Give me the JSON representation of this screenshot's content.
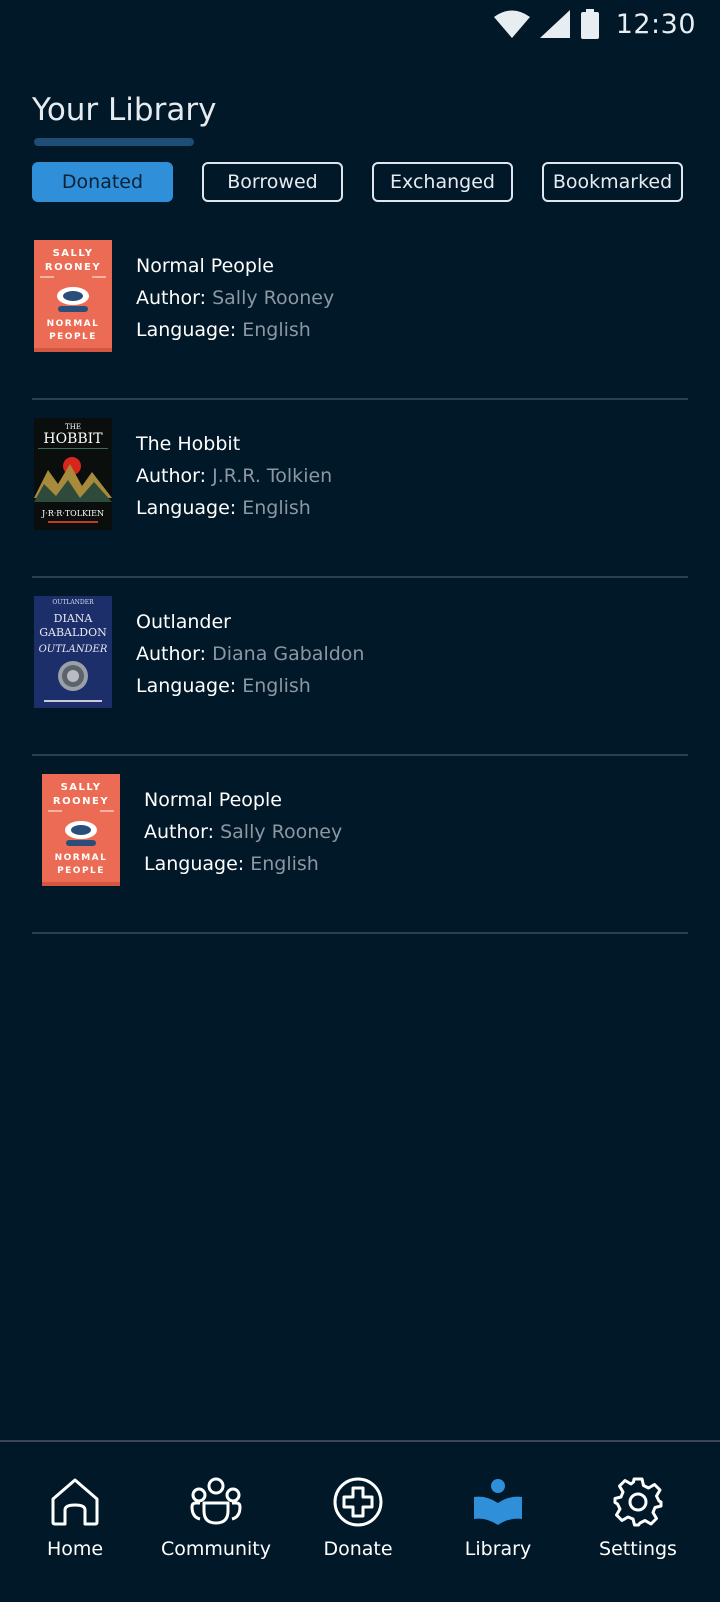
{
  "status_bar": {
    "time": "12:30"
  },
  "header": {
    "title": "Your Library"
  },
  "tabs": [
    {
      "label": "Donated",
      "active": true
    },
    {
      "label": "Borrowed",
      "active": false
    },
    {
      "label": "Exchanged",
      "active": false
    },
    {
      "label": "Bookmarked",
      "active": false
    }
  ],
  "books": [
    {
      "title": "Normal People",
      "author_label": "Author:",
      "author": "Sally Rooney",
      "language_label": "Language:",
      "language": "English",
      "cover": {
        "line1": "SALLY",
        "line2": "ROONEY",
        "line3": "NORMAL",
        "line4": "PEOPLE"
      }
    },
    {
      "title": "The Hobbit",
      "author_label": "Author:",
      "author": "J.R.R. Tolkien",
      "language_label": "Language:",
      "language": "English",
      "cover": {
        "line1": "THE",
        "line2": "HOBBIT",
        "line3": "J·R·R·TOLKIEN"
      }
    },
    {
      "title": "Outlander",
      "author_label": "Author:",
      "author": "Diana Gabaldon",
      "language_label": "Language:",
      "language": "English",
      "cover": {
        "line1": "OUTLANDER",
        "line2": "DIANA",
        "line3": "GABALDON",
        "line4": "OUTLANDER"
      }
    },
    {
      "title": "Normal People",
      "author_label": "Author:",
      "author": "Sally Rooney",
      "language_label": "Language:",
      "language": "English",
      "cover": {
        "line1": "SALLY",
        "line2": "ROONEY",
        "line3": "NORMAL",
        "line4": "PEOPLE"
      }
    }
  ],
  "bottom_nav": [
    {
      "label": "Home",
      "icon": "home-icon",
      "active": false
    },
    {
      "label": "Community",
      "icon": "community-icon",
      "active": false
    },
    {
      "label": "Donate",
      "icon": "donate-icon",
      "active": false
    },
    {
      "label": "Library",
      "icon": "library-icon",
      "active": true
    },
    {
      "label": "Settings",
      "icon": "settings-icon",
      "active": false
    }
  ],
  "colors": {
    "background": "#001828",
    "accent": "#2f8fd8",
    "secondary_text": "#8b97a2",
    "divider": "#2d3e4d"
  }
}
